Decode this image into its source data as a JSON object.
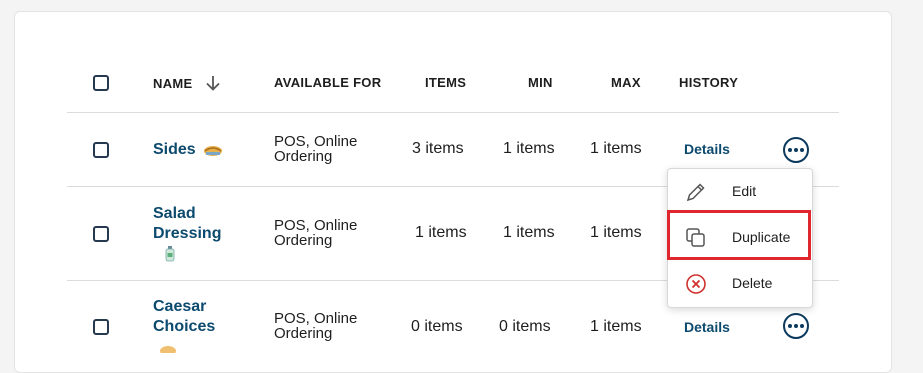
{
  "columns": {
    "name": "NAME",
    "available_for": "AVAILABLE FOR",
    "items": "ITEMS",
    "min": "MIN",
    "max": "MAX",
    "history": "HISTORY"
  },
  "rows": [
    {
      "name": "Sides",
      "avail_line1": "POS, Online",
      "avail_line2": "Ordering",
      "items": "3 items",
      "min": "1 items",
      "max": "1 items",
      "history": "Details",
      "icon": "bread-icon"
    },
    {
      "name_line1": "Salad",
      "name_line2": "Dressing",
      "avail_line1": "POS, Online",
      "avail_line2": "Ordering",
      "items": "1 items",
      "min": "1 items",
      "max": "1 items",
      "icon": "bottle-icon"
    },
    {
      "name_line1": "Caesar",
      "name_line2": "Choices",
      "avail_line1": "POS, Online",
      "avail_line2": "Ordering",
      "items": "0 items",
      "min": "0 items",
      "max": "1 items",
      "history": "Details",
      "icon": "food-icon"
    }
  ],
  "menu": {
    "edit": "Edit",
    "duplicate": "Duplicate",
    "delete": "Delete"
  },
  "colors": {
    "link": "#0c4a6e",
    "highlight": "#e0262e",
    "delete": "#d0312d"
  }
}
